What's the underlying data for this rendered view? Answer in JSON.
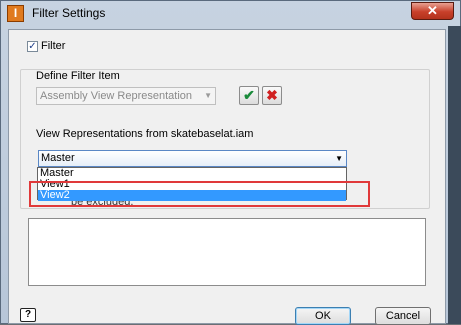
{
  "window": {
    "title": "Filter Settings",
    "close_glyph": "✕",
    "app_icon": "I"
  },
  "filter": {
    "checkbox_label": "Filter",
    "checked": true,
    "check_glyph": "✓"
  },
  "define_item": {
    "group_label": "Define Filter Item",
    "type_combo_value": "Assembly View Representation",
    "accept_glyph": "✔",
    "reject_glyph": "✖"
  },
  "view_reps": {
    "label": "View Representations from skatebaselat.iam",
    "selected_value": "Master",
    "options": [
      "Master",
      "View1",
      "View2"
    ],
    "highlighted_option": "View2",
    "obscured_text": "be excluded."
  },
  "buttons": {
    "help": "?",
    "ok": "OK",
    "cancel": "Cancel"
  },
  "colors": {
    "highlight": "#3399ff",
    "annotation_box": "#e0393a"
  }
}
